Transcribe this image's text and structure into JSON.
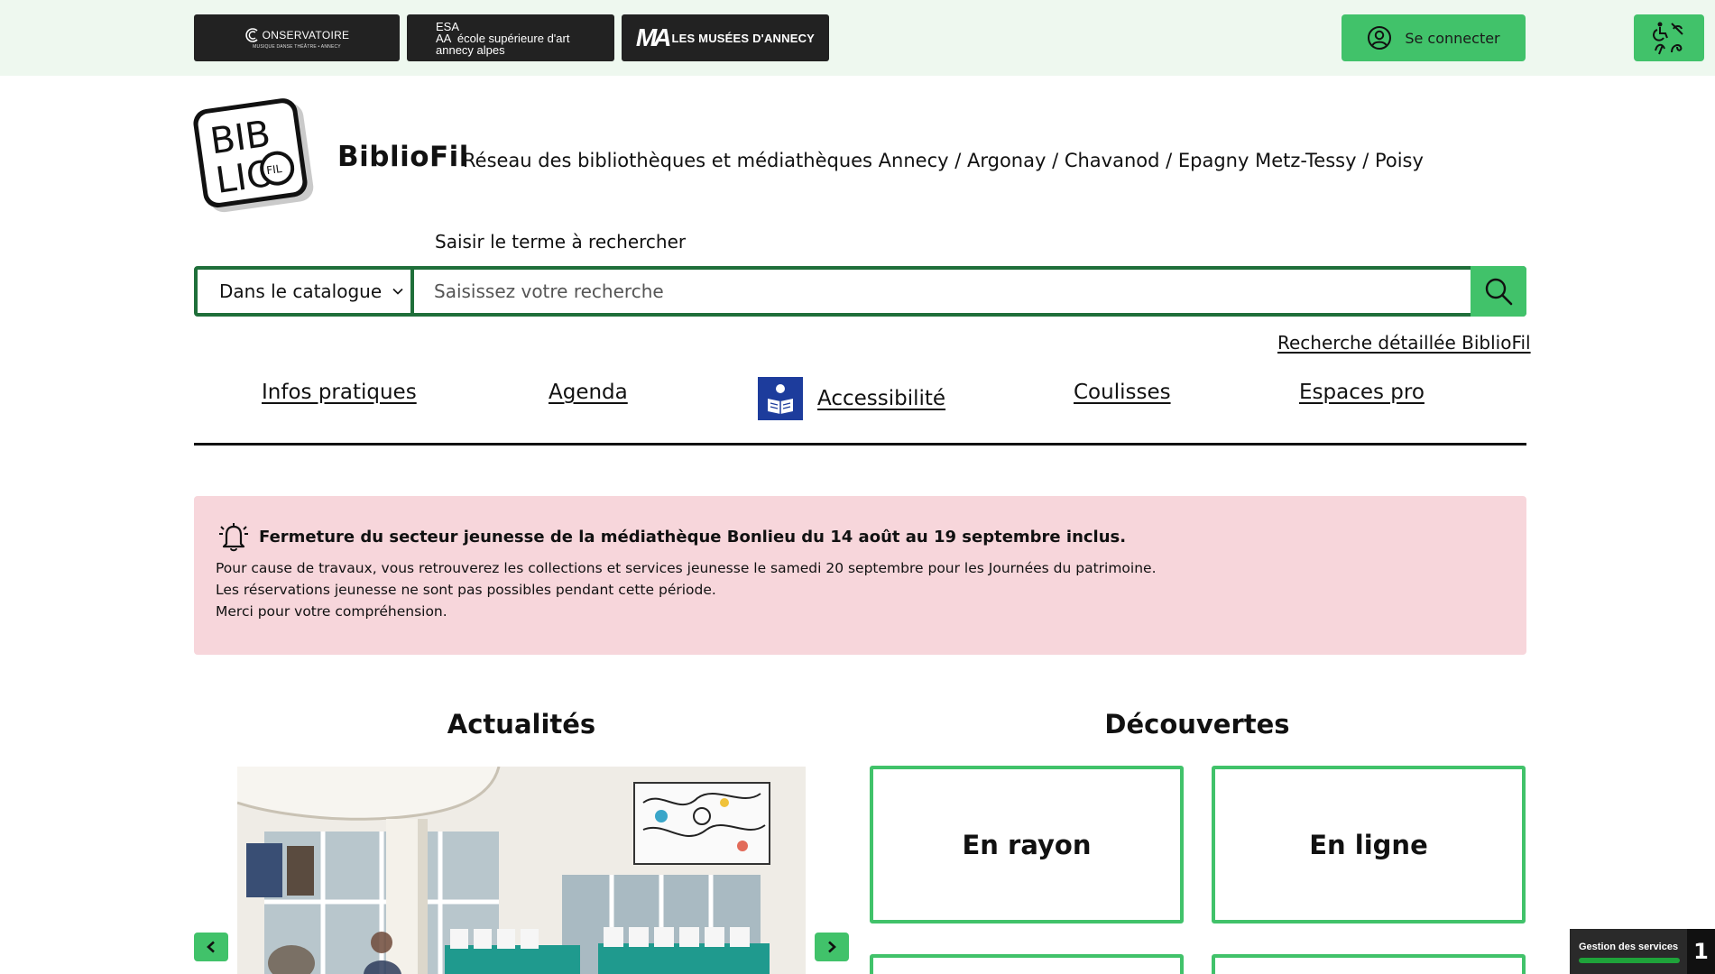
{
  "topbar": {
    "partners": {
      "conservatoire": {
        "name": "ONSERVATOIRE",
        "sub": "MUSIQUE DANSE THÉÂTRE • ANNECY"
      },
      "esa": {
        "line1": "ESA",
        "line2": "AA  école supérieure d'art",
        "line3": "annecy alpes"
      },
      "musees": {
        "mark": "MA",
        "name": "LES MUSÉES D'ANNECY"
      }
    },
    "login_label": "Se connecter"
  },
  "header": {
    "brand": "BiblioFil",
    "tagline": "Réseau des bibliothèques et médiathèques Annecy / Argonay / Chavanod / Epagny Metz-Tessy / Poisy"
  },
  "search": {
    "label": "Saisir le terme à rechercher",
    "scope": "Dans le catalogue",
    "placeholder": "Saisissez votre recherche",
    "advanced": "Recherche détaillée BiblioFil"
  },
  "nav": {
    "items": [
      "Infos pratiques",
      "Agenda",
      "Accessibilité",
      "Coulisses",
      "Espaces pro"
    ]
  },
  "alert": {
    "title": "Fermeture du secteur jeunesse de la médiathèque Bonlieu du 14 août au 19 septembre inclus.",
    "lines": [
      "Pour cause de travaux, vous retrouverez les collections et services jeunesse le samedi 20 septembre pour les Journées du patrimoine.",
      "Les réservations jeunesse ne sont pas possibles pendant cette période.",
      "Merci pour votre compréhension."
    ]
  },
  "sections": {
    "actualites": "Actualités",
    "decouvertes": "Découvertes",
    "tiles": [
      "En rayon",
      "En ligne"
    ]
  },
  "cookie": {
    "label": "Gestion des services",
    "count": "1"
  },
  "colors": {
    "accent": "#41c26a",
    "accent_dark": "#1f6f3a",
    "alert_bg": "#f7d6db",
    "topbar_bg": "#eef8ef",
    "a11y_badge": "#1d3c9c"
  }
}
